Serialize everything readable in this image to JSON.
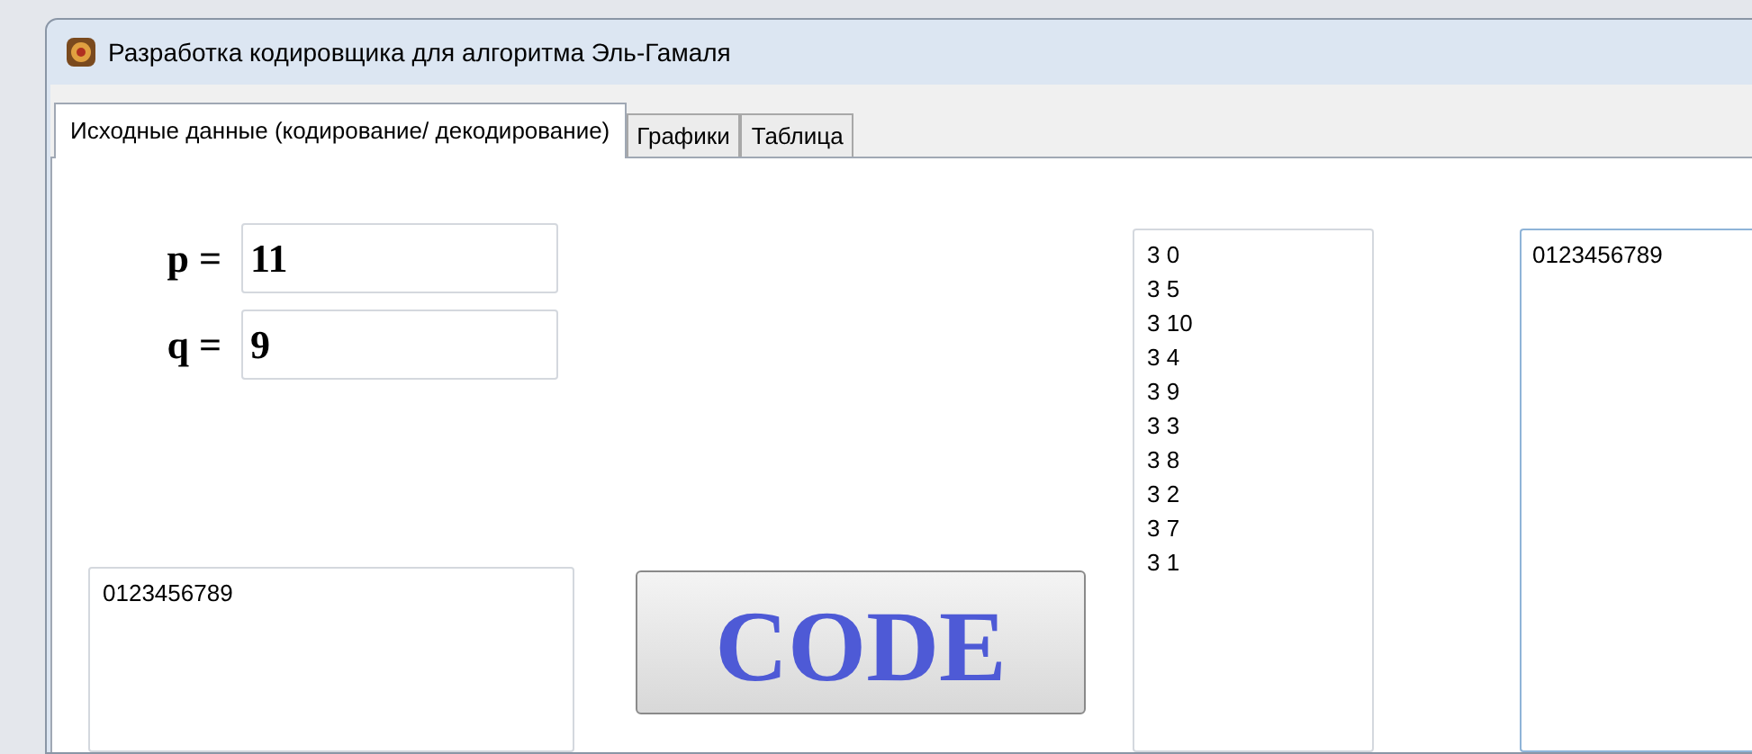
{
  "window": {
    "title": "Разработка кодировщика для алгоритма Эль-Гамаля"
  },
  "tabs": [
    {
      "label": "Исходные данные (кодирование/ декодирование)",
      "selected": true
    },
    {
      "label": "Графики",
      "selected": false
    },
    {
      "label": "Таблица",
      "selected": false
    }
  ],
  "params": [
    {
      "label": "p =",
      "value": "11"
    },
    {
      "label": "q =",
      "value": "9"
    }
  ],
  "input_text": "0123456789",
  "code_button": "CODE",
  "cipher_list": [
    "3 0",
    "3 5",
    "3 10",
    "3 4",
    "3 9",
    "3 3",
    "3 8",
    "3 2",
    "3 7",
    "3 1"
  ],
  "output_text": "0123456789"
}
